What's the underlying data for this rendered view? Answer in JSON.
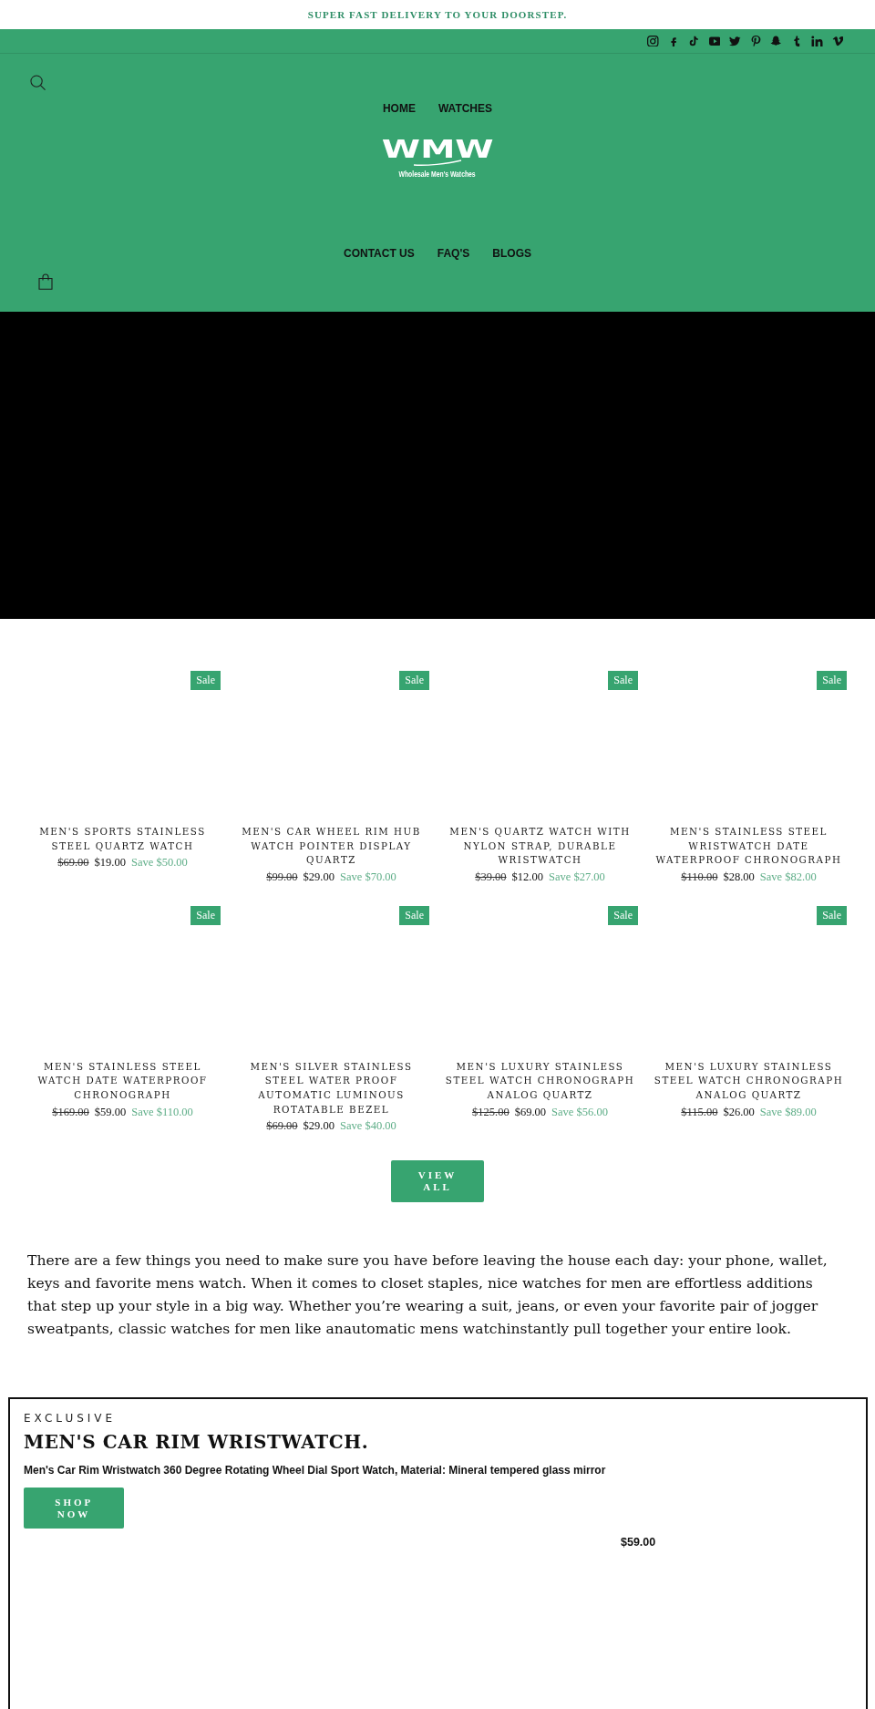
{
  "announcement": {
    "text": "SUPER FAST DELIVERY TO YOUR DOORSTEP."
  },
  "header": {
    "nav_primary": [
      {
        "label": "HOME"
      },
      {
        "label": "WATCHES"
      }
    ],
    "logo": {
      "text": "WMW",
      "tagline": "Wholesale Men's Watches"
    },
    "nav_secondary": [
      {
        "label": "CONTACT US"
      },
      {
        "label": "FAQ'S"
      },
      {
        "label": "BLOGS"
      }
    ]
  },
  "products": [
    {
      "badge": "Sale",
      "title": "MEN'S SPORTS STAINLESS STEEL QUARTZ WATCH",
      "compare_price": "$69.00",
      "price": "$19.00",
      "savings": "Save $50.00"
    },
    {
      "badge": "Sale",
      "title": "MEN'S CAR WHEEL RIM HUB WATCH POINTER DISPLAY QUARTZ",
      "compare_price": "$99.00",
      "price": "$29.00",
      "savings": "Save $70.00"
    },
    {
      "badge": "Sale",
      "title": "MEN'S QUARTZ WATCH WITH NYLON STRAP, DURABLE WRISTWATCH",
      "compare_price": "$39.00",
      "price": "$12.00",
      "savings": "Save $27.00"
    },
    {
      "badge": "Sale",
      "title": "MEN'S STAINLESS STEEL WRISTWATCH DATE WATERPROOF CHRONOGRAPH",
      "compare_price": "$110.00",
      "price": "$28.00",
      "savings": "Save $82.00"
    },
    {
      "badge": "Sale",
      "title": "MEN'S STAINLESS STEEL WATCH DATE WATERPROOF CHRONOGRAPH",
      "compare_price": "$169.00",
      "price": "$59.00",
      "savings": "Save $110.00"
    },
    {
      "badge": "Sale",
      "title": "MEN'S SILVER STAINLESS STEEL WATER PROOF AUTOMATIC LUMINOUS ROTATABLE BEZEL",
      "compare_price": "$69.00",
      "price": "$29.00",
      "savings": "Save $40.00"
    },
    {
      "badge": "Sale",
      "title": "MEN'S LUXURY STAINLESS STEEL WATCH CHRONOGRAPH ANALOG QUARTZ",
      "compare_price": "$125.00",
      "price": "$69.00",
      "savings": "Save $56.00"
    },
    {
      "badge": "Sale",
      "title": "MEN'S LUXURY STAINLESS STEEL WATCH CHRONOGRAPH ANALOG QUARTZ",
      "compare_price": "$115.00",
      "price": "$26.00",
      "savings": "Save $89.00"
    }
  ],
  "view_all": {
    "label": "VIEW ALL"
  },
  "intro_text": "There are a few things you need to make sure you have before leaving the house each day: your phone, wallet, keys and favorite mens watch. When it comes to closet staples, nice watches for men are effortless additions that step up your style in a big way. Whether you’re wearing a suit, jeans, or even your favorite pair of jogger sweatpants, classic watches for men like anautomatic mens watchinstantly pull together your entire look.",
  "featured": {
    "eyebrow": "EXCLUSIVE",
    "title": "MEN'S CAR RIM WRISTWATCH.",
    "description": "Men's Car Rim Wristwatch 360 Degree Rotating Wheel Dial Sport Watch, Material: Mineral tempered glass mirror",
    "button": "SHOP NOW",
    "price": "$59.00"
  }
}
